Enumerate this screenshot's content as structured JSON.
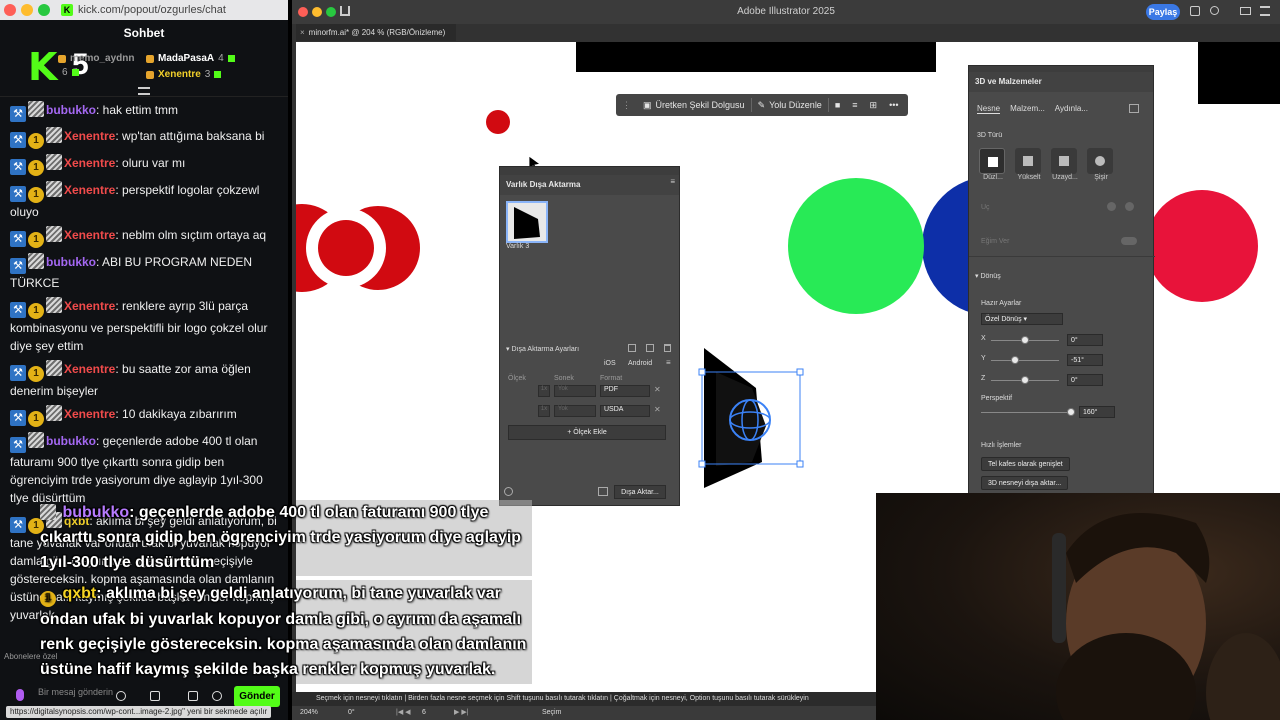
{
  "chat_window": {
    "url": "kick.com/popout/ozgurles/chat",
    "title": "Sohbet",
    "logo_text": "K",
    "logo_num": "5",
    "gifters": [
      {
        "name": "memo_aydnn",
        "count": "6"
      },
      {
        "name": "MadaPasaA",
        "count": "4"
      },
      {
        "name": "Xenentre",
        "count": "3"
      }
    ],
    "messages": [
      {
        "user": "bubukko",
        "color": "purple",
        "mod": true,
        "sub": false,
        "text": ": hak ettim tmm"
      },
      {
        "user": "Xenentre",
        "color": "red",
        "mod": true,
        "sub": true,
        "text": ": wp'tan attığıma baksana bi"
      },
      {
        "user": "Xenentre",
        "color": "red",
        "mod": true,
        "sub": true,
        "text": ": oluru var mı"
      },
      {
        "user": "Xenentre",
        "color": "red",
        "mod": true,
        "sub": true,
        "text": ": perspektif logolar çokzewl oluyo"
      },
      {
        "user": "Xenentre",
        "color": "red",
        "mod": true,
        "sub": true,
        "text": ": neblm olm sıçtım ortaya aq"
      },
      {
        "user": "bubukko",
        "color": "purple",
        "mod": true,
        "sub": false,
        "text": ": ABI BU PROGRAM NEDEN TÜRKCE"
      },
      {
        "user": "Xenentre",
        "color": "red",
        "mod": true,
        "sub": true,
        "text": ": renklere ayrıp 3lü parça kombinasyonu ve perspektifli bir logo çokzel olur diye şey ettim"
      },
      {
        "user": "Xenentre",
        "color": "red",
        "mod": true,
        "sub": true,
        "text": ": bu saatte zor ama öğlen denerim bişeyler"
      },
      {
        "user": "Xenentre",
        "color": "red",
        "mod": true,
        "sub": true,
        "text": ": 10 dakikaya zıbarırım"
      },
      {
        "user": "bubukko",
        "color": "purple",
        "mod": true,
        "sub": false,
        "text": ": geçenlerde adobe 400 tl olan faturamı 900 tlye çıkarttı sonra gidip ben ögrenciyim trde yasiyorum diye aglayip 1yıl-300 tlye düsürttüm"
      },
      {
        "user": "qxbt",
        "color": "yellow",
        "mod": true,
        "sub": true,
        "text": ": aklıma bi şey geldi anlatıyorum, bi tane yuvarlak var ondan ufak bi yuvarlak kopuyor damla gibi, o ayrımı da aşamalı renk geçişiyle göstereceksin. kopma aşamasında olan damlanın üstüne hafif kaymış şekilde başka renkler kopmuş yuvarlak."
      }
    ],
    "subscribers_label": "Abonelere özel",
    "input_placeholder": "Bir mesaj gönderin",
    "send_label": "Gönder",
    "status_url": "https://digitalsynopsis.com/wp-cont...image-2.jpg\" yeni bir sekmede açılır"
  },
  "illustrator": {
    "app_title": "Adobe Illustrator 2025",
    "share_label": "Paylaş",
    "doc_tab": "minorfm.ai* @ 204 % (RGB/Önizleme)",
    "context_bar": {
      "gen_fill": "Üretken Şekil Dolgusu",
      "path_edit": "Yolu Düzenle"
    },
    "export_panel": {
      "title": "Varlık Dışa Aktarma",
      "asset_name": "Varlık 3",
      "settings_label": "Dışa Aktarma Ayarları",
      "ios": "iOS",
      "android": "Android",
      "col_scale": "Ölçek",
      "col_suffix": "Sonek",
      "col_format": "Format",
      "row1_scale": "1x",
      "row1_suffix": "Yok",
      "row1_format": "PDF",
      "row2_scale": "1x",
      "row2_suffix": "Yok",
      "row2_format": "USDA",
      "add_scale": "Ölçek Ekle",
      "export_btn": "Dışa Aktar..."
    },
    "materials_panel": {
      "title": "3D ve Malzemeler",
      "tabs": [
        "Nesne",
        "Malzem...",
        "Aydınla..."
      ],
      "type_label": "3D Türü",
      "types": [
        "Düzl...",
        "Yükselt",
        "Uzayd...",
        "Şişir"
      ],
      "depth_label": "Uç",
      "twist_label": "Eğim Ver",
      "rotation_label": "Dönüş",
      "presets_label": "Hazır Ayarlar",
      "preset_value": "Özel Dönüş",
      "x_label": "X",
      "x_value": "0°",
      "y_label": "Y",
      "y_value": "-51°",
      "z_label": "Z",
      "z_value": "0°",
      "perspective_label": "Perspektif",
      "perspective_value": "160°",
      "quick_label": "Hızlı İşlemler",
      "quick_btn1": "Tel kafes olarak genişlet",
      "quick_btn2": "3D nesneyi dışa aktar..."
    },
    "status_text": "Seçmek için nesneyi tıklatın | Birden fazla nesne seçmek için Shift tuşunu basılı tutarak tıklatın | Çoğaltmak için nesneyi, Option tuşunu basılı tutarak sürükleyin",
    "zoom": "204%",
    "rotation": "0°",
    "artboard": "6",
    "tool": "Seçim"
  },
  "overlay_captions": {
    "cap1_user": "bubukko",
    "cap1_text": ": geçenlerde adobe 400 tl olan faturamı 900 tlye çıkarttı sonra gidip ben ögrenciyim trde yasiyorum diye aglayip 1yıl-300 tlye düsürttüm",
    "cap2_user": "qxbt",
    "cap2_text": ": aklıma bi şey geldi anlatıyorum, bi tane yuvarlak var ondan ufak bi yuvarlak kopuyor damla gibi, o ayrımı da aşamalı renk geçişiyle göstereceksin. kopma aşamasında olan damlanın üstüne hafif kaymış şekilde başka renkler kopmuş yuvarlak."
  },
  "colors": {
    "kick_green": "#53fc18",
    "shape_red": "#d10a11",
    "shape_green": "#28ea56",
    "shape_blue": "#0d2fa8",
    "shape_pink": "#e8133a"
  }
}
